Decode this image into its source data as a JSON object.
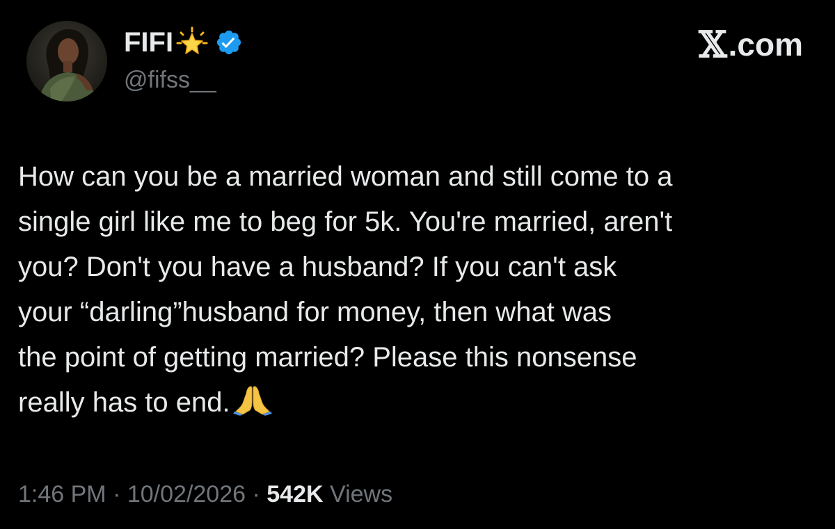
{
  "author": {
    "display_name": "FIFI",
    "badge_emoji_icon": "glowing-star-icon",
    "verified_icon": "verified-badge-icon",
    "verified_color": "#1d9bf0",
    "handle": "@fifss__",
    "avatar_icon": "profile-photo-avatar"
  },
  "brand": {
    "x_mark": "𝕏",
    "suffix": ".com"
  },
  "tweet": {
    "lines": [
      "How can you be a married woman and still come to a",
      "single girl like me to beg for 5k. You're married, aren't",
      "you? Don't you have a husband? If you can't ask",
      "your “darling”husband for money, then what was",
      "the point of getting married? Please this nonsense",
      "really has to end."
    ],
    "end_emoji_icon": "folded-hands-icon"
  },
  "meta": {
    "time": "1:46 PM",
    "separator": "·",
    "date": "10/02/2026",
    "views_count": "542K",
    "views_label": "Views"
  },
  "colors": {
    "background": "#000000",
    "primary_text": "#e7e9ea",
    "secondary_text": "#71767b",
    "accent": "#1d9bf0"
  }
}
